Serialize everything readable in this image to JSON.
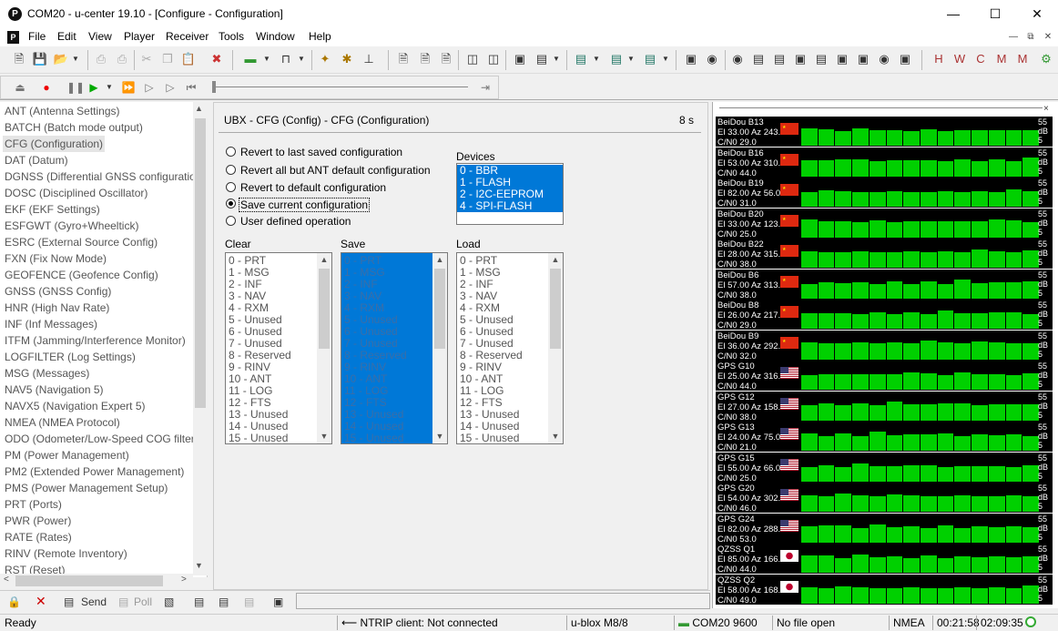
{
  "window": {
    "title": "COM20 - u-center 19.10 - [Configure - Configuration]",
    "minimize": "—",
    "maximize": "☐",
    "close": "✕"
  },
  "menu": [
    "File",
    "Edit",
    "View",
    "Player",
    "Receiver",
    "Tools",
    "Window",
    "Help"
  ],
  "messages": [
    "ANT (Antenna Settings)",
    "BATCH (Batch mode output)",
    "CFG (Configuration)",
    "DAT (Datum)",
    "DGNSS (Differential GNSS configuration",
    "DOSC (Disciplined Oscillator)",
    "EKF (EKF Settings)",
    "ESFGWT (Gyro+Wheeltick)",
    "ESRC (External Source Config)",
    "FXN (Fix Now Mode)",
    "GEOFENCE (Geofence Config)",
    "GNSS (GNSS Config)",
    "HNR (High Nav Rate)",
    "INF (Inf Messages)",
    "ITFM (Jamming/Interference Monitor)",
    "LOGFILTER (Log Settings)",
    "MSG (Messages)",
    "NAV5 (Navigation 5)",
    "NAVX5 (Navigation Expert 5)",
    "NMEA (NMEA Protocol)",
    "ODO (Odometer/Low-Speed COG filter)",
    "PM (Power Management)",
    "PM2 (Extended Power Management)",
    "PMS (Power Management Setup)",
    "PRT (Ports)",
    "PWR (Power)",
    "RATE (Rates)",
    "RINV (Remote Inventory)",
    "RST (Reset)"
  ],
  "cfg": {
    "header": "UBX - CFG (Config) - CFG (Configuration)",
    "timer": "8 s",
    "radios": [
      "Revert to last saved configuration",
      "Revert all but ANT default configuration",
      "Revert to default configuration",
      "Save current configuration",
      "User defined operation"
    ],
    "selected_radio": 3,
    "devices_title": "Devices",
    "devices": [
      "0 - BBR",
      "1 - FLASH",
      "2 - I2C-EEPROM",
      "4 - SPI-FLASH"
    ],
    "clear_title": "Clear",
    "save_title": "Save",
    "load_title": "Load",
    "sections": [
      "0 - PRT",
      "1 - MSG",
      "2 - INF",
      "3 - NAV",
      "4 - RXM",
      "5 - Unused",
      "6 - Unused",
      "7 - Unused",
      "8 - Reserved",
      "9 - RINV",
      "10 - ANT",
      "11 - LOG",
      "12 - FTS",
      "13 - Unused",
      "14 - Unused",
      "15 - Unused"
    ]
  },
  "satellites": [
    {
      "name": "BeiDou B13",
      "pos": "El 33.00 Az 243.",
      "cn0": "C/N0 29.0",
      "flag": "cn"
    },
    {
      "name": "BeiDou B16",
      "pos": "El 53.00 Az 310.",
      "cn0": "C/N0 44.0",
      "flag": "cn"
    },
    {
      "name": "BeiDou B19",
      "pos": "El 82.00 Az 56.0",
      "cn0": "C/N0 31.0",
      "flag": "cn"
    },
    {
      "name": "BeiDou B20",
      "pos": "El 33.00 Az 123.",
      "cn0": "C/N0 25.0",
      "flag": "cn"
    },
    {
      "name": "BeiDou B22",
      "pos": "El 28.00 Az 315.",
      "cn0": "C/N0 38.0",
      "flag": "cn"
    },
    {
      "name": "BeiDou B6",
      "pos": "El 57.00 Az 313.",
      "cn0": "C/N0 38.0",
      "flag": "cn"
    },
    {
      "name": "BeiDou B8",
      "pos": "El 26.00 Az 217.",
      "cn0": "C/N0 29.0",
      "flag": "cn"
    },
    {
      "name": "BeiDou B9",
      "pos": "El 36.00 Az 292.",
      "cn0": "C/N0 32.0",
      "flag": "cn"
    },
    {
      "name": "GPS G10",
      "pos": "El 25.00 Az 316.",
      "cn0": "C/N0 44.0",
      "flag": "us"
    },
    {
      "name": "GPS G12",
      "pos": "El 27.00 Az 158.",
      "cn0": "C/N0 38.0",
      "flag": "us"
    },
    {
      "name": "GPS G13",
      "pos": "El 24.00 Az 75.0",
      "cn0": "C/N0 21.0",
      "flag": "us"
    },
    {
      "name": "GPS G15",
      "pos": "El 55.00 Az 66.0",
      "cn0": "C/N0 25.0",
      "flag": "us"
    },
    {
      "name": "GPS G20",
      "pos": "El 54.00 Az 302.",
      "cn0": "C/N0 46.0",
      "flag": "us"
    },
    {
      "name": "GPS G24",
      "pos": "El 82.00 Az 288.",
      "cn0": "C/N0 53.0",
      "flag": "us"
    },
    {
      "name": "QZSS Q1",
      "pos": "El 85.00 Az 166.",
      "cn0": "C/N0 44.0",
      "flag": "jp"
    },
    {
      "name": "QZSS Q2",
      "pos": "El 58.00 Az 168.",
      "cn0": "C/N0 49.0",
      "flag": "jp"
    }
  ],
  "scale": {
    "top": "55",
    "unit": "dB",
    "bottom": "5"
  },
  "bottom": {
    "send": "Send",
    "poll": "Poll"
  },
  "status": {
    "ready": "Ready",
    "ntrip": "NTRIP client: Not connected",
    "receiver": "u-blox M8/8",
    "port": "COM20 9600",
    "file": "No file open",
    "protocol": "NMEA",
    "time1": "00:21:58",
    "time2": "02:09:35"
  },
  "colors": {
    "accent": "#0078d7",
    "signal": "#00d000"
  }
}
